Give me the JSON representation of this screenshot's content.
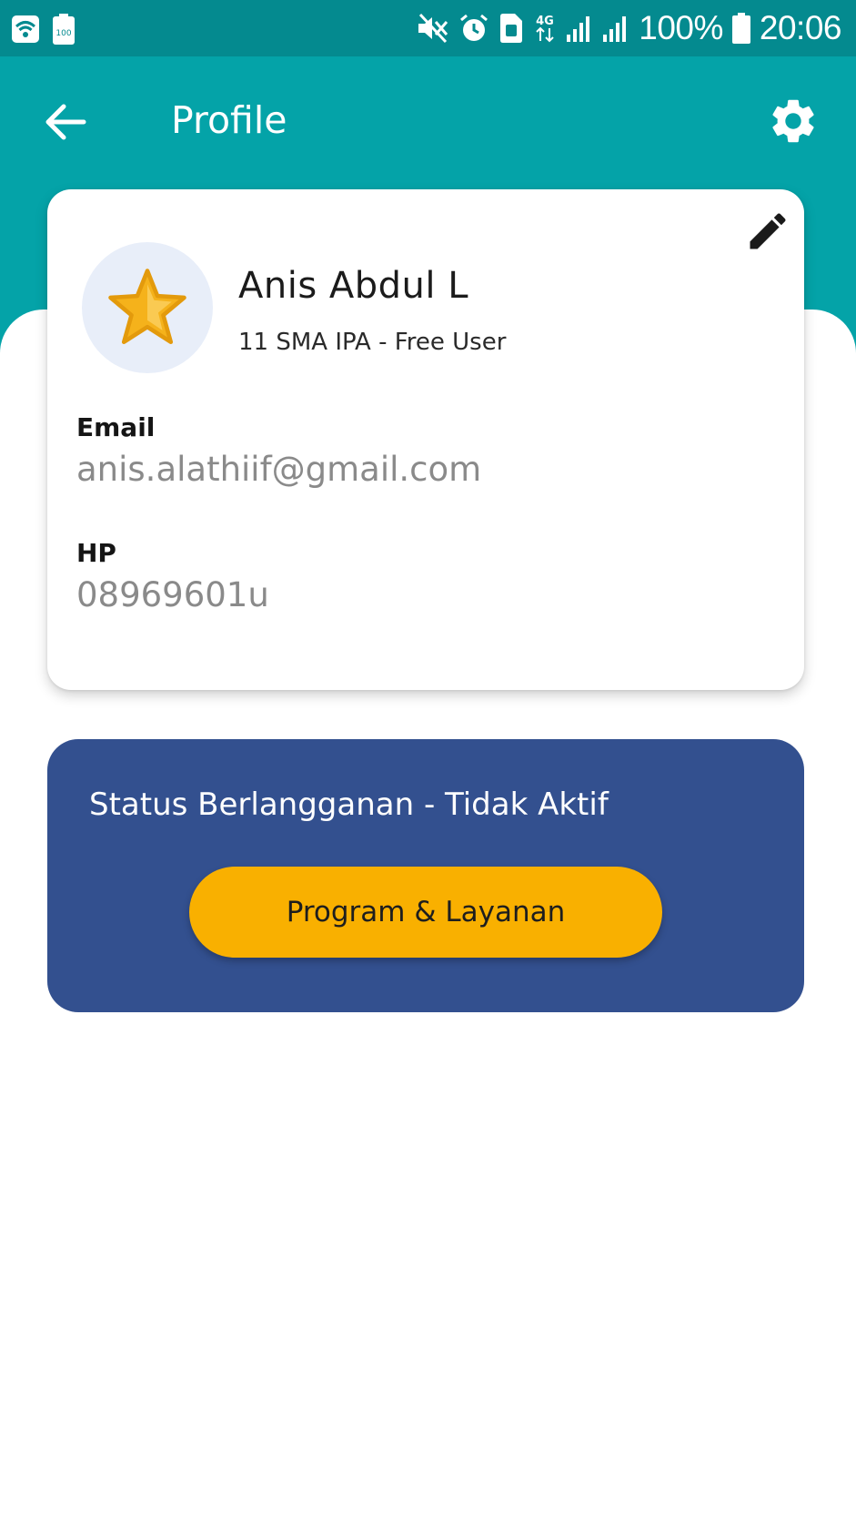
{
  "status_bar": {
    "battery_badge": "100",
    "network_type": "4G",
    "battery_percent": "100%",
    "time": "20:06",
    "icons": [
      "wifi-icon",
      "battery-saver-icon",
      "mute-icon",
      "alarm-icon",
      "sim-icon",
      "data-arrows-icon",
      "signal-icon",
      "signal-icon",
      "battery-icon"
    ]
  },
  "app_bar": {
    "title": "Profile",
    "back_icon": "arrow-left-icon",
    "settings_icon": "gear-icon"
  },
  "profile": {
    "name": "Anis Abdul L",
    "subtitle": "11 SMA IPA - Free User",
    "avatar_icon": "star-icon",
    "edit_icon": "pencil-icon",
    "email_label": "Email",
    "email_value": "anis.alathiif@gmail.com",
    "phone_label": "HP",
    "phone_value": "08969601u"
  },
  "subscription": {
    "status_text": "Status Berlangganan - Tidak Aktif",
    "button_label": "Program & Layanan"
  },
  "colors": {
    "status_bar": "#048a8f",
    "app_bar": "#04a3a8",
    "subscription_card": "#33508f",
    "button": "#f9b000",
    "star": "#f5b21b"
  }
}
